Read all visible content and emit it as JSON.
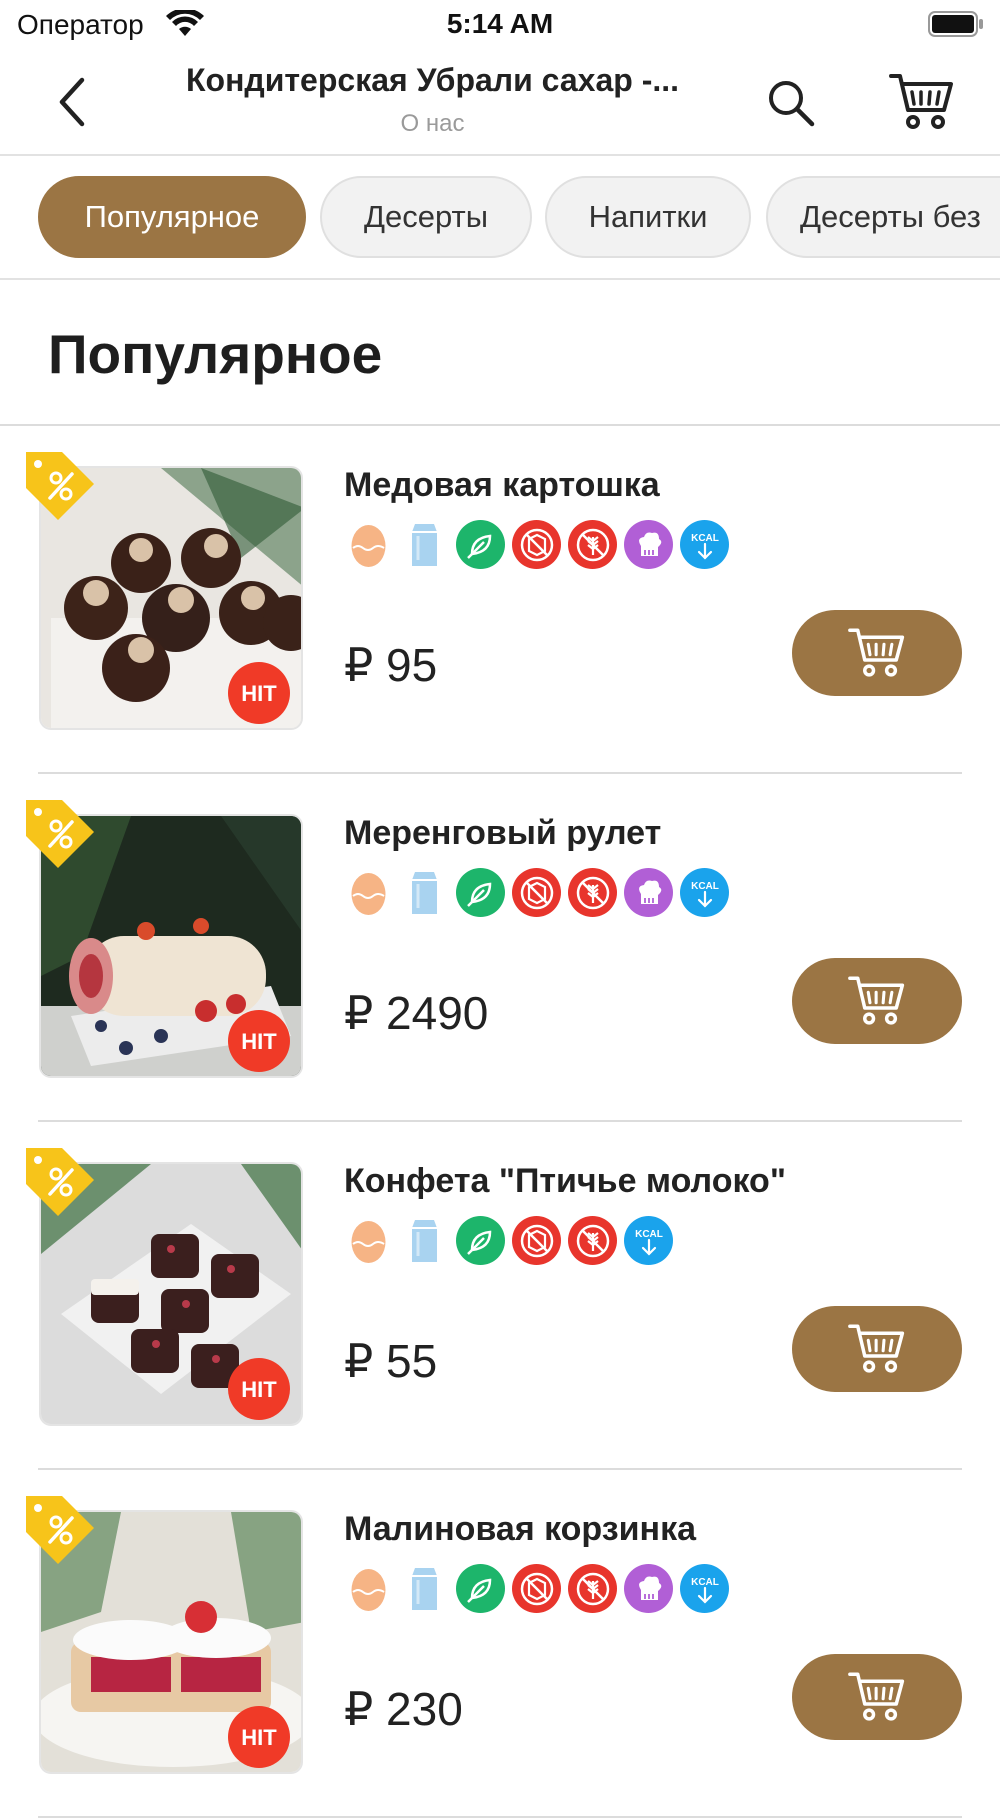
{
  "status_bar": {
    "carrier": "Оператор",
    "time": "5:14 AM"
  },
  "nav": {
    "title": "Кондитерская Убрали сахар -...",
    "subtitle": "О нас"
  },
  "tabs": [
    {
      "label": "Популярное",
      "active": true
    },
    {
      "label": "Десерты",
      "active": false
    },
    {
      "label": "Напитки",
      "active": false
    },
    {
      "label": "Десерты без",
      "active": false
    }
  ],
  "section": {
    "title": "Популярное"
  },
  "products": [
    {
      "name": "Медовая картошка",
      "price": "₽ 95",
      "badges": [
        "egg-icon",
        "milk-icon",
        "vegan-icon",
        "no-sugar-icon",
        "gluten-free-icon",
        "chef-icon",
        "kcal-icon"
      ],
      "hit_label": "HIT"
    },
    {
      "name": "Меренговый рулет",
      "price": "₽ 2490",
      "badges": [
        "egg-icon",
        "milk-icon",
        "vegan-icon",
        "no-sugar-icon",
        "gluten-free-icon",
        "chef-icon",
        "kcal-icon"
      ],
      "hit_label": "HIT"
    },
    {
      "name": "Конфета \"Птичье молоко\"",
      "price": "₽ 55",
      "badges": [
        "egg-icon",
        "milk-icon",
        "vegan-icon",
        "no-sugar-icon",
        "gluten-free-icon",
        "kcal-icon"
      ],
      "hit_label": "HIT"
    },
    {
      "name": "Малиновая корзинка",
      "price": "₽ 230",
      "badges": [
        "egg-icon",
        "milk-icon",
        "vegan-icon",
        "no-sugar-icon",
        "gluten-free-icon",
        "chef-icon",
        "kcal-icon"
      ],
      "hit_label": "HIT"
    }
  ],
  "badge_text": {
    "kcal": "KCAL"
  },
  "colors": {
    "accent": "#9b7544",
    "hit": "#f03a27",
    "discount_tag": "#f7c41a",
    "vegan": "#1db56b",
    "no_sugar": "#e8352c",
    "chef": "#b15fd6",
    "kcal": "#1aa3ec",
    "egg": "#f6b485",
    "milk": "#a9d3f0"
  }
}
